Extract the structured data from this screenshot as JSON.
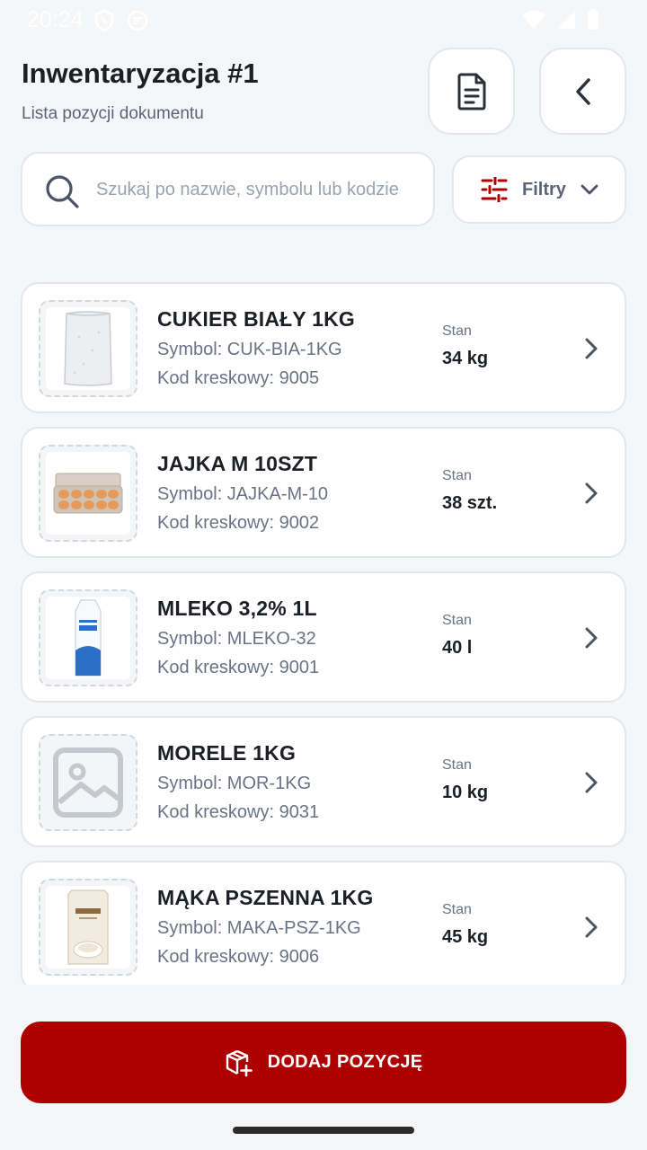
{
  "status_bar": {
    "time": "20:24"
  },
  "header": {
    "title": "Inwentaryzacja #1",
    "subtitle": "Lista pozycji dokumentu",
    "doc_button_icon": "document-icon",
    "back_button_icon": "chevron-left-icon"
  },
  "search": {
    "placeholder": "Szukaj po nazwie, symbolu lub kodzie",
    "value": ""
  },
  "filter": {
    "label": "Filtry"
  },
  "items": [
    {
      "name": "CUKIER BIAŁY 1KG",
      "symbol": "Symbol: CUK-BIA-1KG",
      "barcode": "Kod kreskowy: 9005",
      "stock_label": "Stan",
      "stock": "34 kg",
      "image": "sugar-bag"
    },
    {
      "name": "JAJKA M 10SZT",
      "symbol": "Symbol: JAJKA-M-10",
      "barcode": "Kod kreskowy: 9002",
      "stock_label": "Stan",
      "stock": "38 szt.",
      "image": "egg-carton"
    },
    {
      "name": "MLEKO 3,2% 1L",
      "symbol": "Symbol: MLEKO-32",
      "barcode": "Kod kreskowy: 9001",
      "stock_label": "Stan",
      "stock": "40 l",
      "image": "milk-carton"
    },
    {
      "name": "MORELE 1KG",
      "symbol": "Symbol: MOR-1KG",
      "barcode": "Kod kreskowy: 9031",
      "stock_label": "Stan",
      "stock": "10 kg",
      "image": "placeholder-image"
    },
    {
      "name": "MĄKA PSZENNA 1KG",
      "symbol": "Symbol: MAKA-PSZ-1KG",
      "barcode": "Kod kreskowy: 9006",
      "stock_label": "Stan",
      "stock": "45 kg",
      "image": "flour-bag"
    }
  ],
  "add_button": {
    "label": "DODAJ POZYCJĘ"
  },
  "colors": {
    "accent": "#ad0000",
    "background": "#f5f6f8",
    "card": "#ffffff",
    "border": "#e3e6ec"
  }
}
